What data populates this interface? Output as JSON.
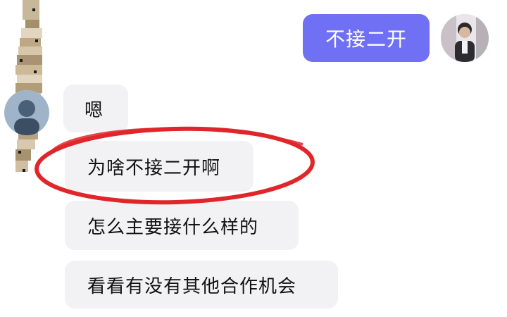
{
  "outgoing": [
    {
      "text": "不接二开"
    }
  ],
  "incoming": [
    {
      "text": "嗯"
    },
    {
      "text": "为啥不接二开啊"
    },
    {
      "text": "怎么主要接什么样的"
    },
    {
      "text": "看看有没有其他合作机会"
    }
  ],
  "colors": {
    "outgoing_bubble": "#6f70f4",
    "incoming_bubble": "#f2f2f4",
    "highlight_ring": "#e0262a"
  },
  "icons": {
    "self_avatar": "avatar",
    "other_avatar": "avatar",
    "redaction": "mosaic-blur"
  }
}
